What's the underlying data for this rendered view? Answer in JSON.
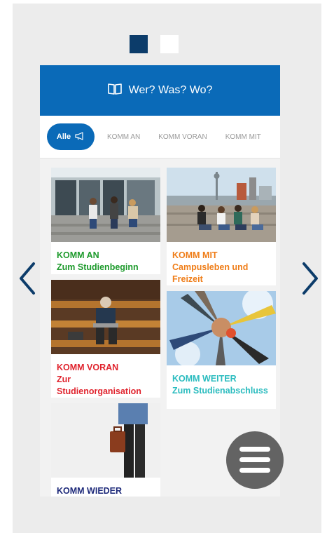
{
  "pager": {
    "count": 2,
    "active": 1
  },
  "header": {
    "title": "Wer? Was? Wo?"
  },
  "tabs": {
    "active_label": "Alle",
    "items": [
      "KOMM AN",
      "KOMM VORAN",
      "KOMM MIT"
    ]
  },
  "cards": [
    {
      "kicker": "KOMM AN",
      "title": "Zum Studienbeginn",
      "color": "#1d9a2c"
    },
    {
      "kicker": "KOMM MIT",
      "title": "Campusleben und Freizeit",
      "color": "#ef7d18"
    },
    {
      "kicker": "KOMM VORAN",
      "title": "Zur Studienorganisation",
      "color": "#e0232d"
    },
    {
      "kicker": "KOMM WEITER",
      "title": "Zum Studienabschluss",
      "color": "#2bbcbf"
    },
    {
      "kicker": "KOMM WIEDER",
      "title": "",
      "color": "#1e2a7a"
    }
  ],
  "colors": {
    "brand_blue": "#0a6ab8",
    "pager_active": "#0c3c6a",
    "fab_gray": "#636363"
  }
}
